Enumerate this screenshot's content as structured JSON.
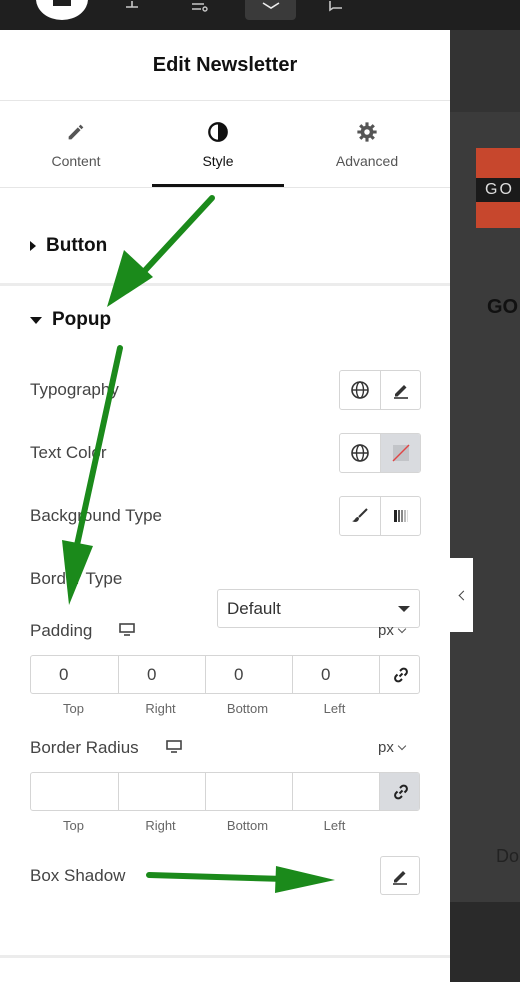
{
  "panel": {
    "title": "Edit Newsletter"
  },
  "tabs": [
    {
      "label": "Content",
      "icon": "pencil-icon"
    },
    {
      "label": "Style",
      "icon": "contrast-icon"
    },
    {
      "label": "Advanced",
      "icon": "gear-icon"
    }
  ],
  "sections": {
    "button": {
      "label": "Button",
      "expanded": false
    },
    "popup": {
      "label": "Popup",
      "expanded": true
    }
  },
  "controls": {
    "typography": {
      "label": "Typography"
    },
    "text_color": {
      "label": "Text Color"
    },
    "background_type": {
      "label": "Background Type"
    },
    "border_type": {
      "label": "Border Type",
      "value": "Default"
    },
    "padding": {
      "label": "Padding",
      "unit": "px",
      "values": [
        "0",
        "0",
        "0",
        "0"
      ],
      "sides": [
        "Top",
        "Right",
        "Bottom",
        "Left"
      ]
    },
    "border_radius": {
      "label": "Border Radius",
      "unit": "px",
      "values": [
        "",
        "",
        "",
        ""
      ],
      "sides": [
        "Top",
        "Right",
        "Bottom",
        "Left"
      ]
    },
    "box_shadow": {
      "label": "Box Shadow"
    }
  },
  "preview": {
    "logo_text": "GO",
    "heading_fragment": "GO",
    "body_fragment": "Do"
  },
  "colors": {
    "annotation_arrow": "#1b8a1b",
    "active_toggle": "#d9dbdf",
    "accent_red": "#c7472d"
  }
}
